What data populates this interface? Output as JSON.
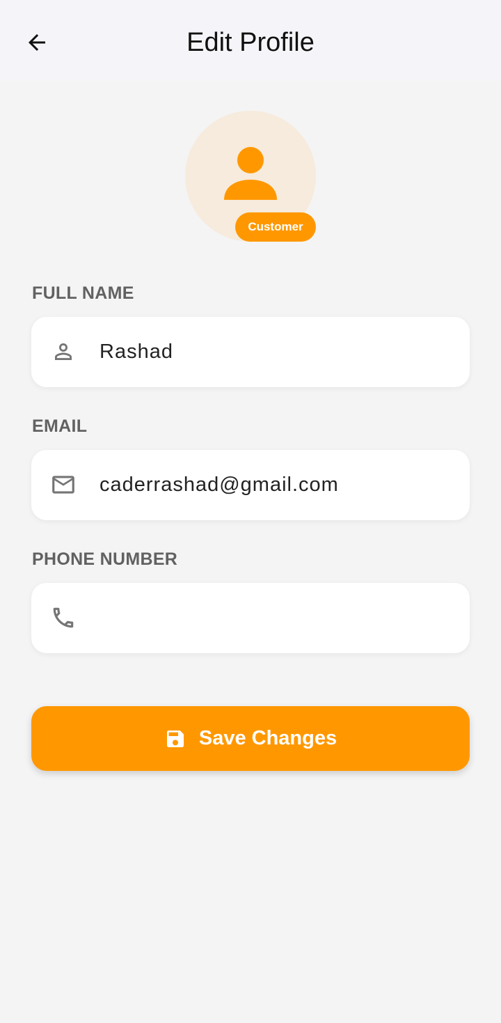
{
  "header": {
    "title": "Edit Profile",
    "back_icon": "arrow-left-icon"
  },
  "profile": {
    "avatar_icon": "person-icon",
    "role_badge": "Customer"
  },
  "form": {
    "full_name": {
      "label": "FULL NAME",
      "icon": "person-outline-icon",
      "value": "Rashad"
    },
    "email": {
      "label": "EMAIL",
      "icon": "mail-icon",
      "value": "caderrashad@gmail.com"
    },
    "phone": {
      "label": "PHONE NUMBER",
      "icon": "phone-icon",
      "value": ""
    }
  },
  "actions": {
    "save_label": "Save Changes",
    "save_icon": "save-icon"
  },
  "colors": {
    "accent": "#ff9800",
    "avatar_bg": "#f6ebdc",
    "background": "#f4f4f5",
    "header_bg": "#f5f5f9",
    "label": "#616161"
  }
}
